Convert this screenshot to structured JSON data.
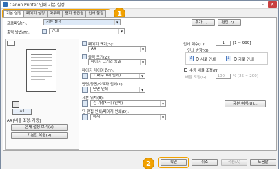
{
  "window": {
    "title": "Canon Printer 인쇄 기본 설정"
  },
  "tabs": [
    "기본 설정",
    "페이지 설정",
    "마무리",
    "용지 공급원",
    "인쇄 품질"
  ],
  "favorites": {
    "label": "프로파일(F):",
    "value": "기본 설정",
    "add": "추가(1)...",
    "edit": "편집(2)..."
  },
  "output": {
    "label": "출력 방법(M):",
    "value": "인쇄"
  },
  "page_size": {
    "label": "페이지 크기(S):",
    "value": "A4"
  },
  "output_size": {
    "label": "출력 크기(Z):",
    "value": "페이지 크기와 동일"
  },
  "copies": {
    "label": "인쇄 매수(C):",
    "value": "1",
    "range": "[1 ~ 999]"
  },
  "orientation": {
    "label": "인쇄 방향(O)",
    "portrait": "세로 인쇄",
    "landscape": "가로 인쇄"
  },
  "layout": {
    "label": "페이지 레이아웃(Y):",
    "value": "1(매수 1매 인쇄)"
  },
  "manual_scale": {
    "label": "수동 배율 조정(N)",
    "scale_label": "배율 조정(G):",
    "value": "100",
    "range": "% [25 ~ 200]"
  },
  "duplex": {
    "label": "단면/양면/소책자 인쇄(T):",
    "value": "단면 인쇄"
  },
  "binding": {
    "label": "제본 위치(B):",
    "value": "긴 가장자리 (왼쪽)"
  },
  "booklet": {
    "label": "단 편집 인쇄/페이지 인쇄(D):",
    "value": "해제"
  },
  "paper_info": "제본 여백(U)...",
  "preview": {
    "caption": "A4 [배율 조정: 자동]",
    "view_settings": "현재 설정 보기(V)",
    "restore": "기본값 복원(R)"
  },
  "footer": {
    "ok": "확인",
    "cancel": "취소",
    "apply": "적용(A)",
    "help": "도움말"
  },
  "callouts": [
    "1",
    "2"
  ],
  "colors": {
    "callout": "#f2a100"
  }
}
